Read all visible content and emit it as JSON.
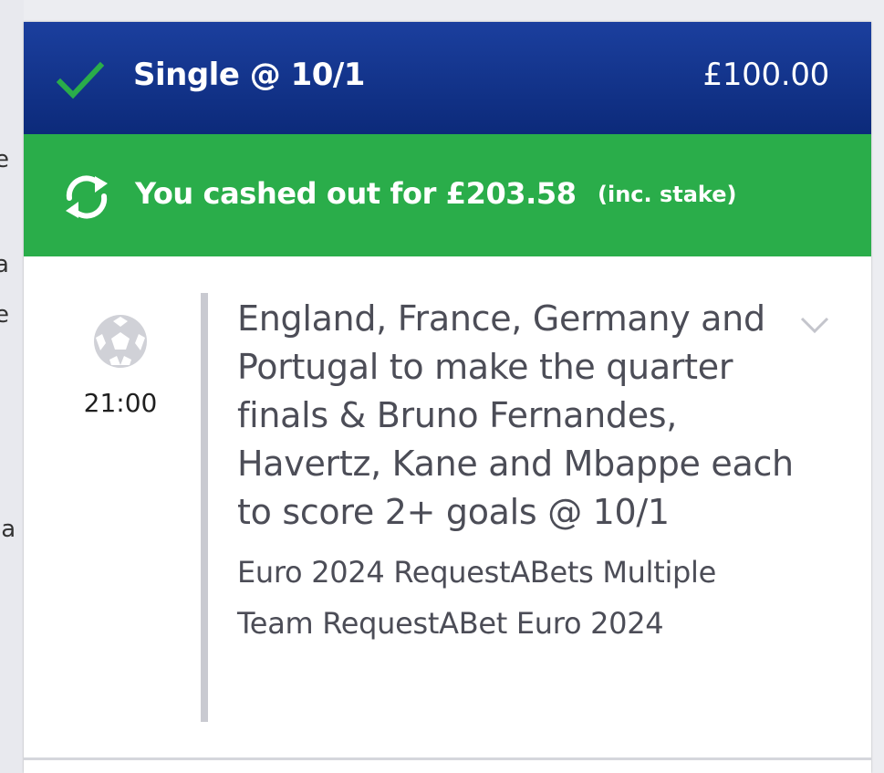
{
  "bet_card": {
    "header": {
      "bet_type": "Single @ 10/1",
      "stake": "£100.00",
      "status_icon": "check-icon"
    },
    "cashout": {
      "icon": "cashout-refresh-icon",
      "text": "You cashed out for £203.58",
      "note": "(inc. stake)"
    },
    "leg": {
      "sport_icon": "football-icon",
      "time": "21:00",
      "selection": "England, France, Germany and Portugal to make the quarter finals & Bruno Fernandes, Havertz, Kane and Mbappe each to score 2+ goals @ 10/1",
      "market": "Euro 2024 RequestABets Multiple Team RequestABet Euro 2024",
      "expand_icon": "chevron-down-icon"
    }
  },
  "colors": {
    "header_bg": "#0c2a7a",
    "cashout_bg": "#2aad4a",
    "check": "#2aad4a",
    "text_dark": "#4c4d57"
  }
}
